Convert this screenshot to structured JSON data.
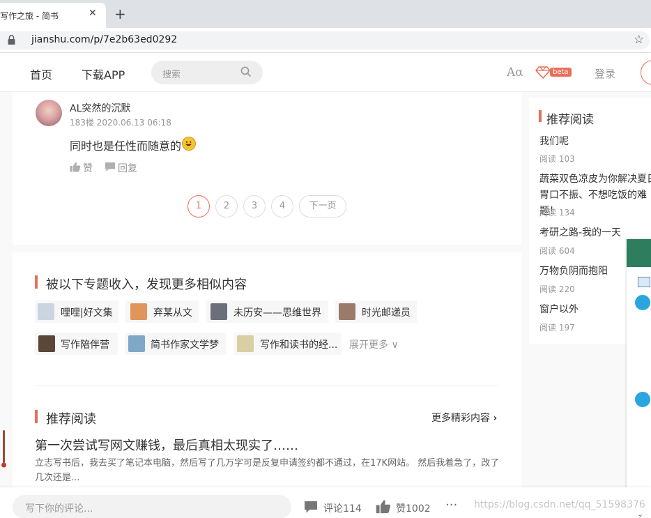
{
  "browser": {
    "tab_title": "写作之旅 - 简书",
    "tab_close": "✕",
    "new_tab": "+",
    "url": "jianshu.com/p/7e2b63ed0292",
    "star": "☆"
  },
  "header": {
    "nav_home": "首页",
    "nav_download": "下载APP",
    "search_placeholder": "搜索",
    "font_icon": "Aα",
    "beta": "beta",
    "login": "登录"
  },
  "comment": {
    "user": "AL突然的沉默",
    "meta": "183楼 2020.06.13 06:18",
    "text": "同时也是任性而随意的",
    "like_label": "赞",
    "reply_label": "回复"
  },
  "pagination": {
    "pages": [
      "1",
      "2",
      "3",
      "4"
    ],
    "next": "下一页",
    "current": "1"
  },
  "collections": {
    "title": "被以下专题收入，发现更多相似内容",
    "items": [
      {
        "label": "哩哩|好文集",
        "color": "#c9d6df"
      },
      {
        "label": "弃某从文",
        "color": "#e0965a"
      },
      {
        "label": "未历安——思维世界",
        "color": "#6b6f7a"
      },
      {
        "label": "时光邮递员",
        "color": "#9a7b6a"
      },
      {
        "label": "写作陪伴营",
        "color": "#5b4638"
      },
      {
        "label": "简书作家文学梦",
        "color": "#7fa8c7"
      },
      {
        "label": "写作和读书的经...",
        "color": "#d8cfa4"
      }
    ],
    "expand": "展开更多",
    "expand_icon": "∨"
  },
  "recommend": {
    "title": "推荐阅读",
    "more": "更多精彩内容",
    "more_icon": "›",
    "article_title": "第一次尝试写网文赚钱，最后真相太现实了……",
    "article_desc": "立志写书后，我去买了笔记本电脑，然后写了几万字可是反复申请签约都不通过，在17K网站。 然后我着急了，改了几次还是..."
  },
  "sidebar": {
    "title": "推荐阅读",
    "items": [
      {
        "title": "我们呢",
        "reads": "阅读 103"
      },
      {
        "title": "蔬菜双色凉皮为你解决夏日胃口不振、不想吃饭的难题！",
        "reads": "阅读 134"
      },
      {
        "title": "考研之路-我的一天",
        "reads": "阅读 604"
      },
      {
        "title": "万物负阴而抱阳",
        "reads": "阅读 220"
      },
      {
        "title": "窗户以外",
        "reads": "阅读 197"
      }
    ]
  },
  "bottom_bar": {
    "comment_placeholder": "写下你的评论...",
    "comment_count": "评论114",
    "like_count": "赞1002",
    "more": "···",
    "watermark": "https://blog.csdn.net/qq_51598376",
    "scroll_down": "⌄"
  },
  "colors": {
    "accent": "#ea6f5a",
    "text": "#333333",
    "muted": "#969696",
    "background": "#f9f9f9"
  }
}
